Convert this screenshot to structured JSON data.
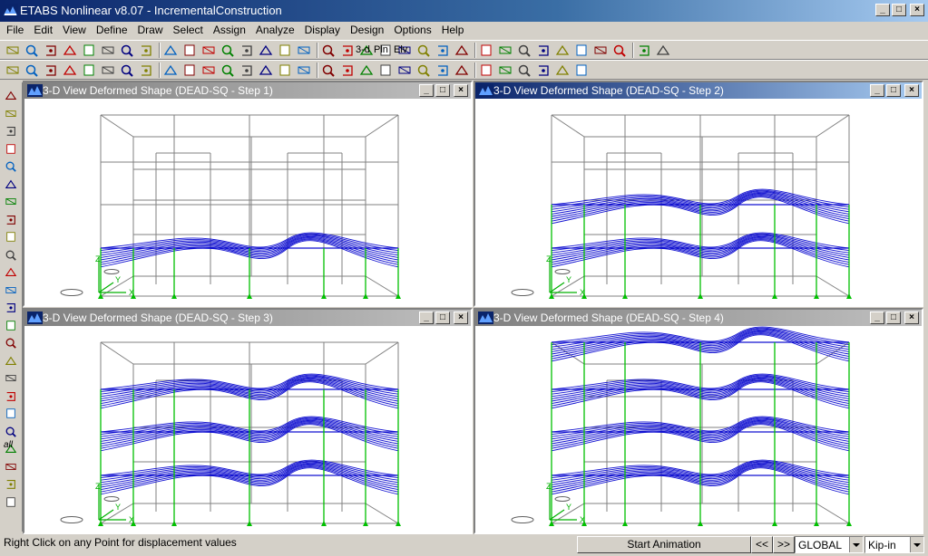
{
  "app": {
    "title": "ETABS Nonlinear v8.07 - IncrementalConstruction"
  },
  "window_buttons": {
    "minimize": "_",
    "maximize": "□",
    "close": "×"
  },
  "menu": [
    "File",
    "Edit",
    "View",
    "Define",
    "Draw",
    "Select",
    "Assign",
    "Analyze",
    "Display",
    "Design",
    "Options",
    "Help"
  ],
  "toolbar1": {
    "icons": [
      "new-file-icon",
      "open-folder-icon",
      "save-icon",
      "print-icon",
      "print-preview-icon",
      "undo-icon",
      "redo-icon",
      "pencil-icon",
      "lock-icon",
      "run-analysis-icon",
      "run-stepped-icon",
      "unlock-icon",
      "zoom-window-icon",
      "zoom-in-icon",
      "zoom-out-icon",
      "zoom-restore-icon",
      "pan-icon",
      "refresh-icon",
      "rotate-3d-icon",
      "plan-view-icon",
      "elevation-view-icon",
      "set-view-icon",
      "perspective-icon",
      "move-up-icon",
      "move-down-icon",
      "object-shrink-icon",
      "display-options-icon",
      "percent-icon",
      "frame-forces-icon",
      "deformed-shape-icon",
      "member-forces-icon",
      "animate-icon",
      "output-table-icon",
      "design-check-icon"
    ],
    "text_3d": "3-d",
    "text_pln": "Pln",
    "text_elv": "Elv"
  },
  "toolbar2": {
    "icons": [
      "draw-line-icon",
      "draw-area-icon",
      "draw-rectangle-icon",
      "draw-point-icon",
      "snap-icon",
      "draw-beam-icon",
      "draw-column-icon",
      "draw-brace-icon",
      "draw-wall-icon",
      "draw-slab-icon",
      "draw-opening-icon",
      "draw-dimension-icon",
      "snap-point-icon",
      "snap-end-icon",
      "snap-mid-icon",
      "snap-intersection-icon",
      "snap-perpendicular-icon",
      "snap-grid-icon",
      "assign-frame-icon",
      "assign-shell-icon",
      "assign-joint-icon",
      "assign-load-icon",
      "assign-diaphragm-icon",
      "section-cut-icon",
      "grid-lines-icon",
      "spring-icon",
      "restraint-icon",
      "constraint-icon",
      "local-axes-icon",
      "shell-section-icon"
    ]
  },
  "lefttoolbar": {
    "icons": [
      "select-pointer-icon",
      "reshape-icon",
      "draw-line-tool-icon",
      "draw-brace-tool-icon",
      "draw-column-tool-icon",
      "draw-beam-tool-icon",
      "draw-cross-icon",
      "draw-area-tool-icon",
      "draw-rect-area-icon",
      "draw-point-tool-icon",
      "draw-horizontal-icon",
      "draw-wall-tool-icon",
      "expand-icon",
      "snap-points-icon",
      "snap-ends-icon",
      "snap-intersect-icon",
      "snap-perpend-icon",
      "snap-lines-icon",
      "snap-fine-icon",
      "select-all-icon",
      "select-previous-icon",
      "select-clear-icon",
      "select-intersect-icon",
      "expand-more-icon"
    ],
    "select_all_label": "all"
  },
  "views": [
    {
      "title": "3-D View  Deformed Shape (DEAD-SQ - Step 1)",
      "step": 1,
      "active": false
    },
    {
      "title": "3-D View  Deformed Shape (DEAD-SQ - Step 2)",
      "step": 2,
      "active": true
    },
    {
      "title": "3-D View  Deformed Shape (DEAD-SQ - Step 3)",
      "step": 3,
      "active": false
    },
    {
      "title": "3-D View  Deformed Shape (DEAD-SQ - Step 4)",
      "step": 4,
      "active": false
    }
  ],
  "axes": {
    "x": "X",
    "y": "Y",
    "z": "Z"
  },
  "colors": {
    "frame": "#808080",
    "deformed": "#1010d0",
    "support": "#00c000",
    "axis": "#00b000"
  },
  "status": {
    "message": "Right Click on any Point for displacement values",
    "start_animation": "Start Animation",
    "prev": "<<",
    "next": ">>",
    "coord_system": "GLOBAL",
    "units": "Kip-in"
  }
}
